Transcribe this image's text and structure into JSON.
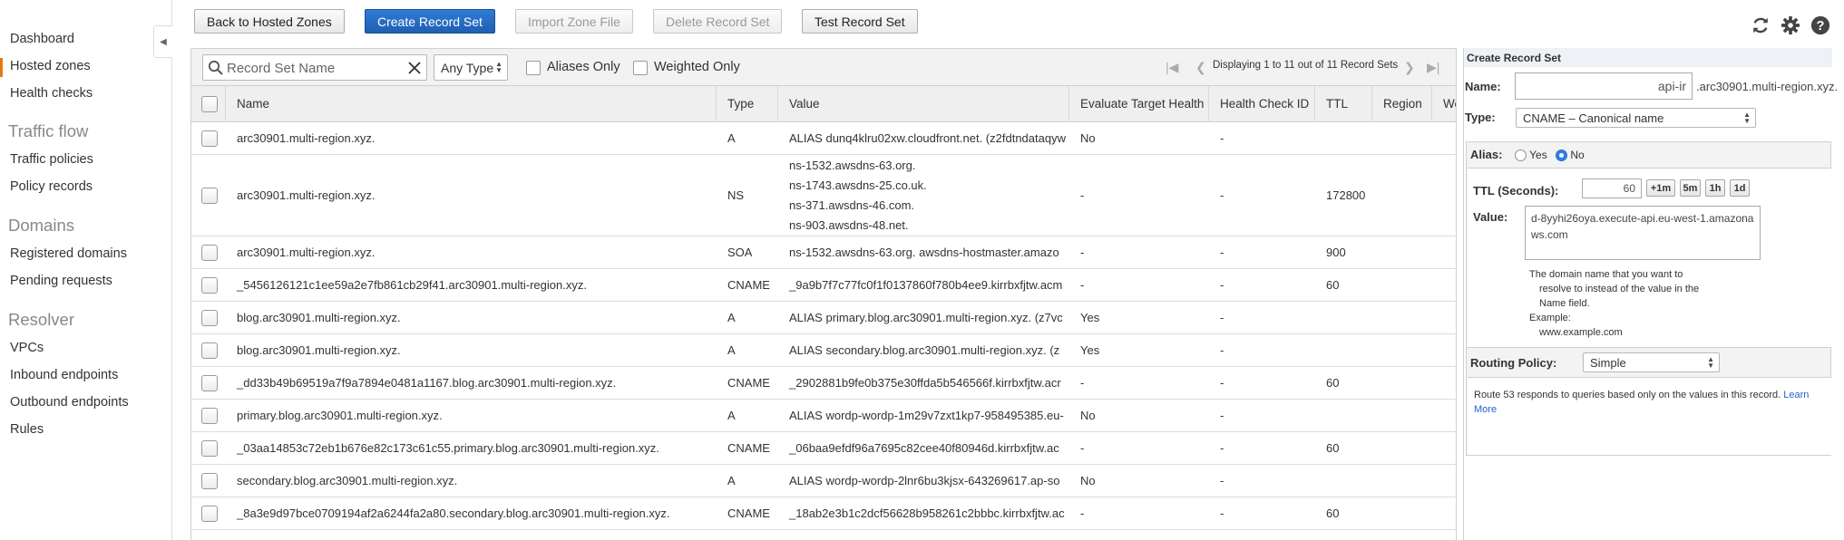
{
  "sidebar": {
    "items": [
      {
        "label": "Dashboard"
      },
      {
        "label": "Hosted zones"
      },
      {
        "label": "Health checks"
      }
    ],
    "sections": [
      {
        "heading": "Traffic flow",
        "items": [
          "Traffic policies",
          "Policy records"
        ]
      },
      {
        "heading": "Domains",
        "items": [
          "Registered domains",
          "Pending requests"
        ]
      },
      {
        "heading": "Resolver",
        "items": [
          "VPCs",
          "Inbound endpoints",
          "Outbound endpoints",
          "Rules"
        ]
      }
    ],
    "active_color": "#e47911"
  },
  "toolbar": {
    "back": "Back to Hosted Zones",
    "create": "Create Record Set",
    "import": "Import Zone File",
    "delete": "Delete Record Set",
    "test": "Test Record Set"
  },
  "top_icons": [
    "refresh-icon",
    "gear-icon",
    "help-icon"
  ],
  "filter": {
    "search_placeholder": "Record Set Name",
    "type": "Any Type",
    "aliases_only": "Aliases Only",
    "weighted_only": "Weighted Only",
    "pager": "Displaying 1 to 11 out of 11 Record Sets"
  },
  "table": {
    "headers": [
      "Name",
      "Type",
      "Value",
      "Evaluate Target Health",
      "Health Check ID",
      "TTL",
      "Region",
      "Weight"
    ],
    "rows": [
      {
        "name": "arc30901.multi-region.xyz.",
        "type": "A",
        "value": [
          "ALIAS dunq4klru02xw.cloudfront.net. (z2fdtndataqyw"
        ],
        "eth": "No",
        "hc": "-",
        "ttl": ""
      },
      {
        "name": "arc30901.multi-region.xyz.",
        "type": "NS",
        "value": [
          "ns-1532.awsdns-63.org.",
          "ns-1743.awsdns-25.co.uk.",
          "ns-371.awsdns-46.com.",
          "ns-903.awsdns-48.net."
        ],
        "eth": "-",
        "hc": "-",
        "ttl": "172800"
      },
      {
        "name": "arc30901.multi-region.xyz.",
        "type": "SOA",
        "value": [
          "ns-1532.awsdns-63.org. awsdns-hostmaster.amazo"
        ],
        "eth": "-",
        "hc": "-",
        "ttl": "900"
      },
      {
        "name": "_5456126121c1ee59a2e7fb861cb29f41.arc30901.multi-region.xyz.",
        "type": "CNAME",
        "value": [
          "_9a9b7f7c77fc0f1f0137860f780b4ee9.kirrbxfjtw.acm"
        ],
        "eth": "-",
        "hc": "-",
        "ttl": "60"
      },
      {
        "name": "blog.arc30901.multi-region.xyz.",
        "type": "A",
        "value": [
          "ALIAS primary.blog.arc30901.multi-region.xyz. (z7vc"
        ],
        "eth": "Yes",
        "hc": "-",
        "ttl": ""
      },
      {
        "name": "blog.arc30901.multi-region.xyz.",
        "type": "A",
        "value": [
          "ALIAS secondary.blog.arc30901.multi-region.xyz. (z"
        ],
        "eth": "Yes",
        "hc": "-",
        "ttl": ""
      },
      {
        "name": "_dd33b49b69519a7f9a7894e0481a1167.blog.arc30901.multi-region.xyz.",
        "type": "CNAME",
        "value": [
          "_2902881b9fe0b375e30ffda5b546566f.kirrbxfjtw.acr"
        ],
        "eth": "-",
        "hc": "-",
        "ttl": "60"
      },
      {
        "name": "primary.blog.arc30901.multi-region.xyz.",
        "type": "A",
        "value": [
          "ALIAS wordp-wordp-1m29v7zxt1kp7-958495385.eu-"
        ],
        "eth": "No",
        "hc": "-",
        "ttl": ""
      },
      {
        "name": "_03aa14853c72eb1b676e82c173c61c55.primary.blog.arc30901.multi-region.xyz.",
        "type": "CNAME",
        "value": [
          "_06baa9efdf96a7695c82cee40f80946d.kirrbxfjtw.ac"
        ],
        "eth": "-",
        "hc": "-",
        "ttl": "60"
      },
      {
        "name": "secondary.blog.arc30901.multi-region.xyz.",
        "type": "A",
        "value": [
          "ALIAS wordp-wordp-2lnr6bu3kjsx-643269617.ap-so"
        ],
        "eth": "No",
        "hc": "-",
        "ttl": ""
      },
      {
        "name": "_8a3e9d97bce0709194af2a6244fa2a80.secondary.blog.arc30901.multi-region.xyz.",
        "type": "CNAME",
        "value": [
          "_18ab2e3b1c2dcf56628b958261c2bbbc.kirrbxfjtw.ac"
        ],
        "eth": "-",
        "hc": "-",
        "ttl": "60"
      }
    ]
  },
  "panel": {
    "title": "Create Record Set",
    "name_label": "Name:",
    "name_value": "api-ir",
    "name_suffix": ".arc30901.multi-region.xyz.",
    "type_label": "Type:",
    "type_value": "CNAME – Canonical name",
    "alias_label": "Alias:",
    "alias_yes": "Yes",
    "alias_no": "No",
    "ttl_label": "TTL (Seconds):",
    "ttl_value": "60",
    "ttl_buttons": [
      "+1m",
      "5m",
      "1h",
      "1d"
    ],
    "value_label": "Value:",
    "value_text": "d-8yyhi26oya.execute-api.eu-west-1.amazonaws.com",
    "help_lines": [
      "The domain name that you want to",
      "resolve to instead of the value in the",
      "Name field.",
      "Example:",
      "www.example.com"
    ],
    "routing_label": "Routing Policy:",
    "routing_value": "Simple",
    "routing_help": "Route 53 responds to queries based only on the values in this record.",
    "learn_more_1": "Learn",
    "learn_more_2": "More"
  }
}
